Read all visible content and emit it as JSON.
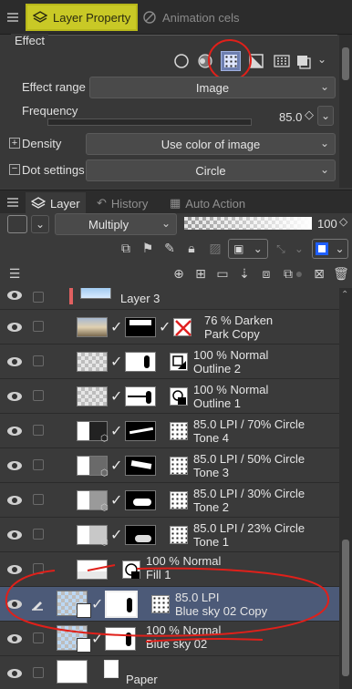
{
  "top_tabs": {
    "layer_property": "Layer Property",
    "animation_cels": "Animation cels"
  },
  "effect": {
    "section_label": "Effect",
    "effect_range_label": "Effect range",
    "effect_range_value": "Image",
    "frequency_label": "Frequency",
    "frequency_value": "85.0",
    "density_label": "Density",
    "density_value": "Use color of image",
    "dot_settings_label": "Dot settings",
    "dot_settings_value": "Circle",
    "frequency_slider_fraction": 0.6
  },
  "layer_tabs": {
    "layer": "Layer",
    "history": "History",
    "auto_action": "Auto Action"
  },
  "layer_toolbar": {
    "blend_mode": "Multiply",
    "opacity": "100"
  },
  "layers": [
    {
      "id": "layer3",
      "line1": "Layer 3",
      "line2": ""
    },
    {
      "id": "park-copy",
      "line1": "76 % Darken",
      "line2": "Park Copy"
    },
    {
      "id": "outline2",
      "line1": "100 % Normal",
      "line2": "Outline 2"
    },
    {
      "id": "outline1",
      "line1": "100 % Normal",
      "line2": "Outline 1"
    },
    {
      "id": "tone4",
      "line1": "85.0 LPI / 70% Circle",
      "line2": "Tone 4"
    },
    {
      "id": "tone3",
      "line1": "85.0 LPI / 50% Circle",
      "line2": "Tone 3"
    },
    {
      "id": "tone2",
      "line1": "85.0 LPI / 30% Circle",
      "line2": "Tone 2"
    },
    {
      "id": "tone1",
      "line1": "85.0 LPI / 23% Circle",
      "line2": "Tone 1"
    },
    {
      "id": "fill1",
      "line1": "100 % Normal",
      "line2": "Fill 1"
    },
    {
      "id": "bluesky-copy",
      "line1": "85.0 LPI",
      "line2": "Blue sky 02 Copy"
    },
    {
      "id": "bluesky",
      "line1": "100 % Normal",
      "line2": "Blue sky 02"
    },
    {
      "id": "paper",
      "line1": "Paper",
      "line2": ""
    }
  ],
  "colors": {
    "active_tab": "#c9c926",
    "selected_row": "#4c5a78",
    "annotation_red": "#e0201a"
  }
}
